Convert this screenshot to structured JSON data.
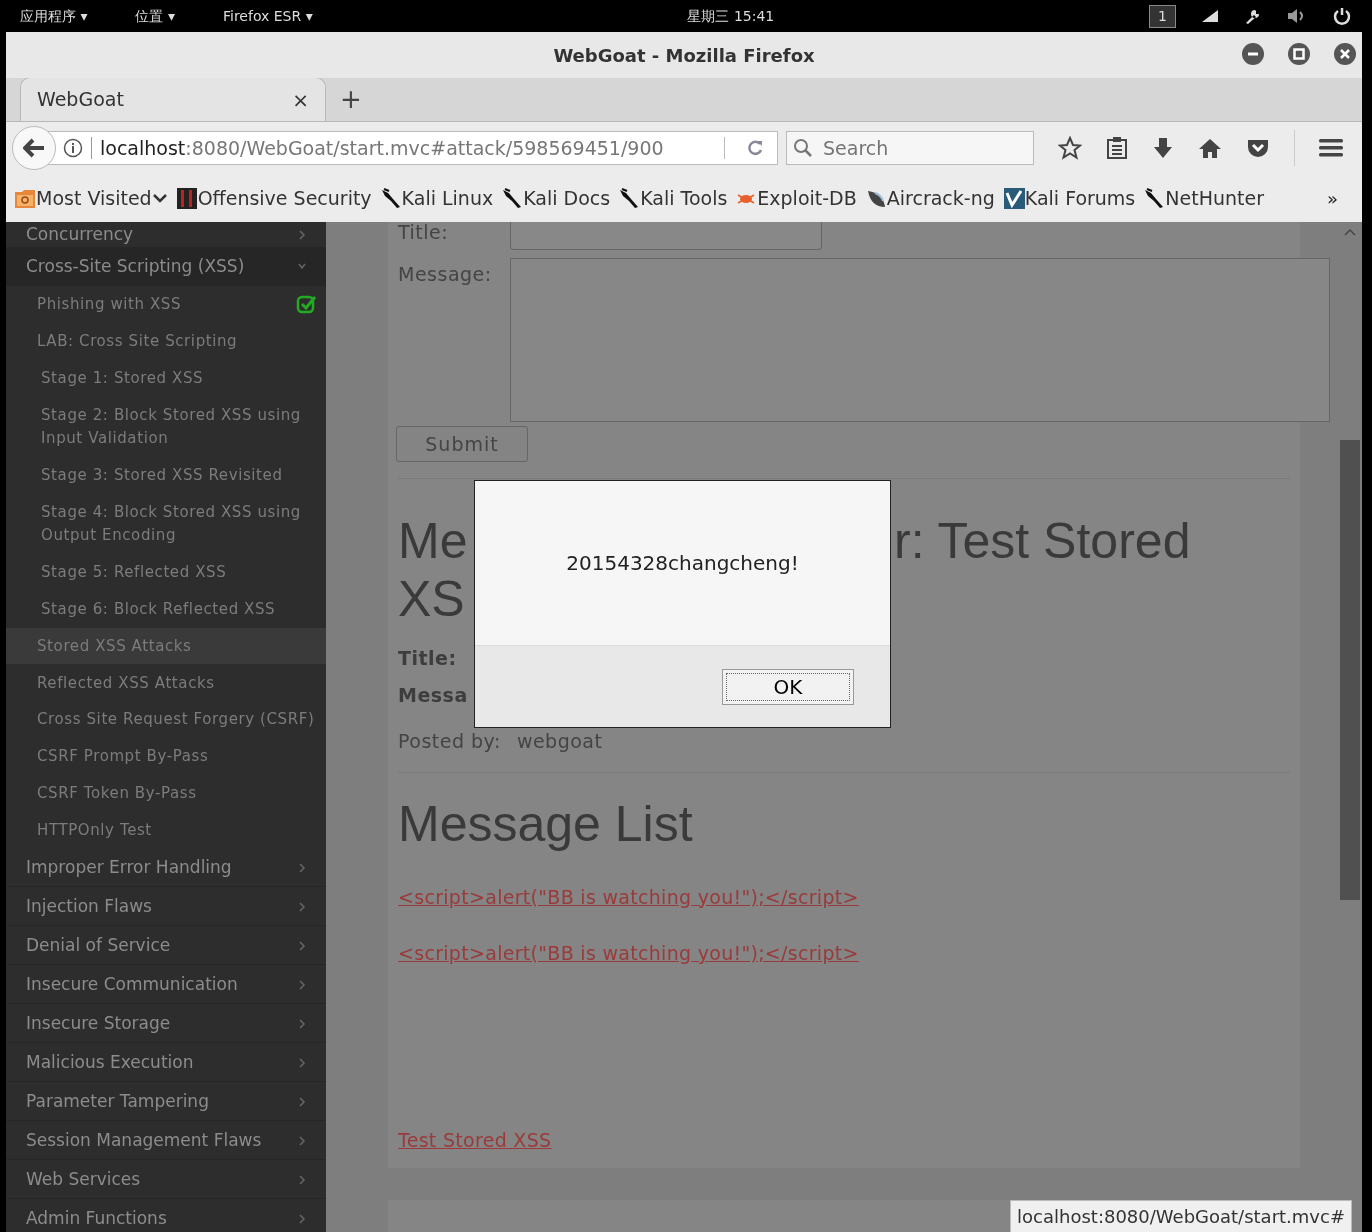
{
  "system_bar": {
    "menus": [
      "应用程序 ▾",
      "位置 ▾",
      "Firefox ESR ▾"
    ],
    "clock": "星期三 15:41",
    "workspace": "1"
  },
  "window": {
    "title": "WebGoat - Mozilla Firefox"
  },
  "tabs": [
    {
      "label": "WebGoat",
      "close": "×",
      "selected": true
    }
  ],
  "new_tab": "+",
  "address": {
    "host": "localhost",
    "path": ":8080/WebGoat/start.mvc#attack/598569451/900"
  },
  "search": {
    "placeholder": "Search"
  },
  "bookmarks": [
    {
      "label": "Most Visited",
      "kind": "folder"
    },
    {
      "label": "Offensive Security",
      "kind": "offsec"
    },
    {
      "label": "Kali Linux",
      "kind": "kali"
    },
    {
      "label": "Kali Docs",
      "kind": "kali"
    },
    {
      "label": "Kali Tools",
      "kind": "kali"
    },
    {
      "label": "Exploit-DB",
      "kind": "exploit"
    },
    {
      "label": "Aircrack-ng",
      "kind": "aircrack"
    },
    {
      "label": "Kali Forums",
      "kind": "forums"
    },
    {
      "label": "NetHunter",
      "kind": "kali"
    }
  ],
  "bookmarks_overflow": "»",
  "sidebar": {
    "items": [
      {
        "label": "Concurrency",
        "expanded": false
      },
      {
        "label": "Cross-Site Scripting (XSS)",
        "expanded": true,
        "children": [
          {
            "label": "Phishing with XSS",
            "completed": true,
            "selected": false
          },
          {
            "label": "LAB: Cross Site Scripting",
            "completed": false,
            "selected": false,
            "children": [
              {
                "label": "Stage 1: Stored XSS"
              },
              {
                "label": "Stage 2: Block Stored XSS using Input Validation"
              },
              {
                "label": "Stage 3: Stored XSS Revisited"
              },
              {
                "label": "Stage 4: Block Stored XSS using Output Encoding"
              },
              {
                "label": "Stage 5: Reflected XSS"
              },
              {
                "label": "Stage 6: Block Reflected XSS"
              }
            ]
          },
          {
            "label": "Stored XSS Attacks",
            "completed": false,
            "selected": true
          },
          {
            "label": "Reflected XSS Attacks",
            "completed": false,
            "selected": false
          },
          {
            "label": "Cross Site Request Forgery (CSRF)",
            "completed": false,
            "selected": false
          },
          {
            "label": "CSRF Prompt By-Pass",
            "completed": false,
            "selected": false
          },
          {
            "label": "CSRF Token By-Pass",
            "completed": false,
            "selected": false
          },
          {
            "label": "HTTPOnly Test",
            "completed": false,
            "selected": false
          }
        ]
      },
      {
        "label": "Improper Error Handling",
        "expanded": false
      },
      {
        "label": "Injection Flaws",
        "expanded": false
      },
      {
        "label": "Denial of Service",
        "expanded": false
      },
      {
        "label": "Insecure Communication",
        "expanded": false
      },
      {
        "label": "Insecure Storage",
        "expanded": false
      },
      {
        "label": "Malicious Execution",
        "expanded": false
      },
      {
        "label": "Parameter Tampering",
        "expanded": false
      },
      {
        "label": "Session Management Flaws",
        "expanded": false
      },
      {
        "label": "Web Services",
        "expanded": false
      },
      {
        "label": "Admin Functions",
        "expanded": false
      }
    ]
  },
  "form": {
    "title_label": "Title:",
    "message_label": "Message:",
    "submit": "Submit"
  },
  "message_heading": {
    "fragments": [
      "Me",
      "r: Test Stored",
      "XS"
    ]
  },
  "message_details": {
    "title_label": "Title:",
    "message_label": "Messa",
    "posted_label": "Posted by:",
    "posted_value": "webgoat"
  },
  "message_list": {
    "heading": "Message List",
    "messages": [
      "<script>alert(\"BB is watching you!\");</script>",
      "<script>alert(\"BB is watching you!\");</script>"
    ]
  },
  "lesson_link": "Test Stored XSS",
  "dialog": {
    "message": "20154328changcheng!",
    "button": "OK"
  },
  "status_url": "localhost:8080/WebGoat/start.mvc#"
}
